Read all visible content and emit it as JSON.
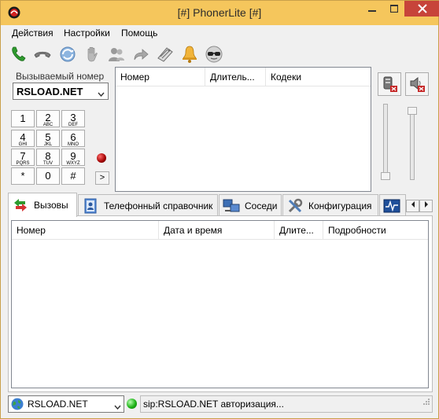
{
  "window": {
    "title": "[#] PhonerLite [#]"
  },
  "menu": {
    "items": [
      "Действия",
      "Настройки",
      "Помощь"
    ]
  },
  "toolbar": {
    "icons": [
      "call-icon",
      "hangup-icon",
      "transfer-icon",
      "hold-icon",
      "conference-icon",
      "forward-icon",
      "mailbox-icon",
      "do-not-disturb-icon",
      "anonymous-icon"
    ]
  },
  "dialer": {
    "label": "Вызываемый номер",
    "number": "RSLOAD.NET",
    "keys": [
      {
        "d": "1",
        "l": ""
      },
      {
        "d": "2",
        "l": "ABC"
      },
      {
        "d": "3",
        "l": "DEF"
      },
      {
        "d": "4",
        "l": "GHI"
      },
      {
        "d": "5",
        "l": "JKL"
      },
      {
        "d": "6",
        "l": "MNO"
      },
      {
        "d": "7",
        "l": "PQRS"
      },
      {
        "d": "8",
        "l": "TUV"
      },
      {
        "d": "9",
        "l": "WXYZ"
      },
      {
        "d": "*",
        "l": ""
      },
      {
        "d": "0",
        "l": ""
      },
      {
        "d": "#",
        "l": ""
      }
    ],
    "expand_label": ">"
  },
  "active_calls": {
    "columns": [
      "Номер",
      "Длитель...",
      "Кодеки"
    ]
  },
  "tabs": [
    {
      "label": "Вызовы",
      "icon": "calls-icon"
    },
    {
      "label": "Телефонный справочник",
      "icon": "phonebook-icon"
    },
    {
      "label": "Соседи",
      "icon": "neighbors-icon"
    },
    {
      "label": "Конфигурация",
      "icon": "configuration-icon"
    },
    {
      "label": "",
      "icon": "monitor-icon"
    }
  ],
  "calls": {
    "columns": [
      "Номер",
      "Дата и время",
      "Длите...",
      "Подробности"
    ]
  },
  "status": {
    "account": "RSLOAD.NET",
    "message": "sip:RSLOAD.NET авторизация..."
  },
  "colors": {
    "titlebar": "#f5c65c",
    "close": "#c7443a",
    "led_red": "#c00000",
    "led_green": "#1fb318"
  }
}
